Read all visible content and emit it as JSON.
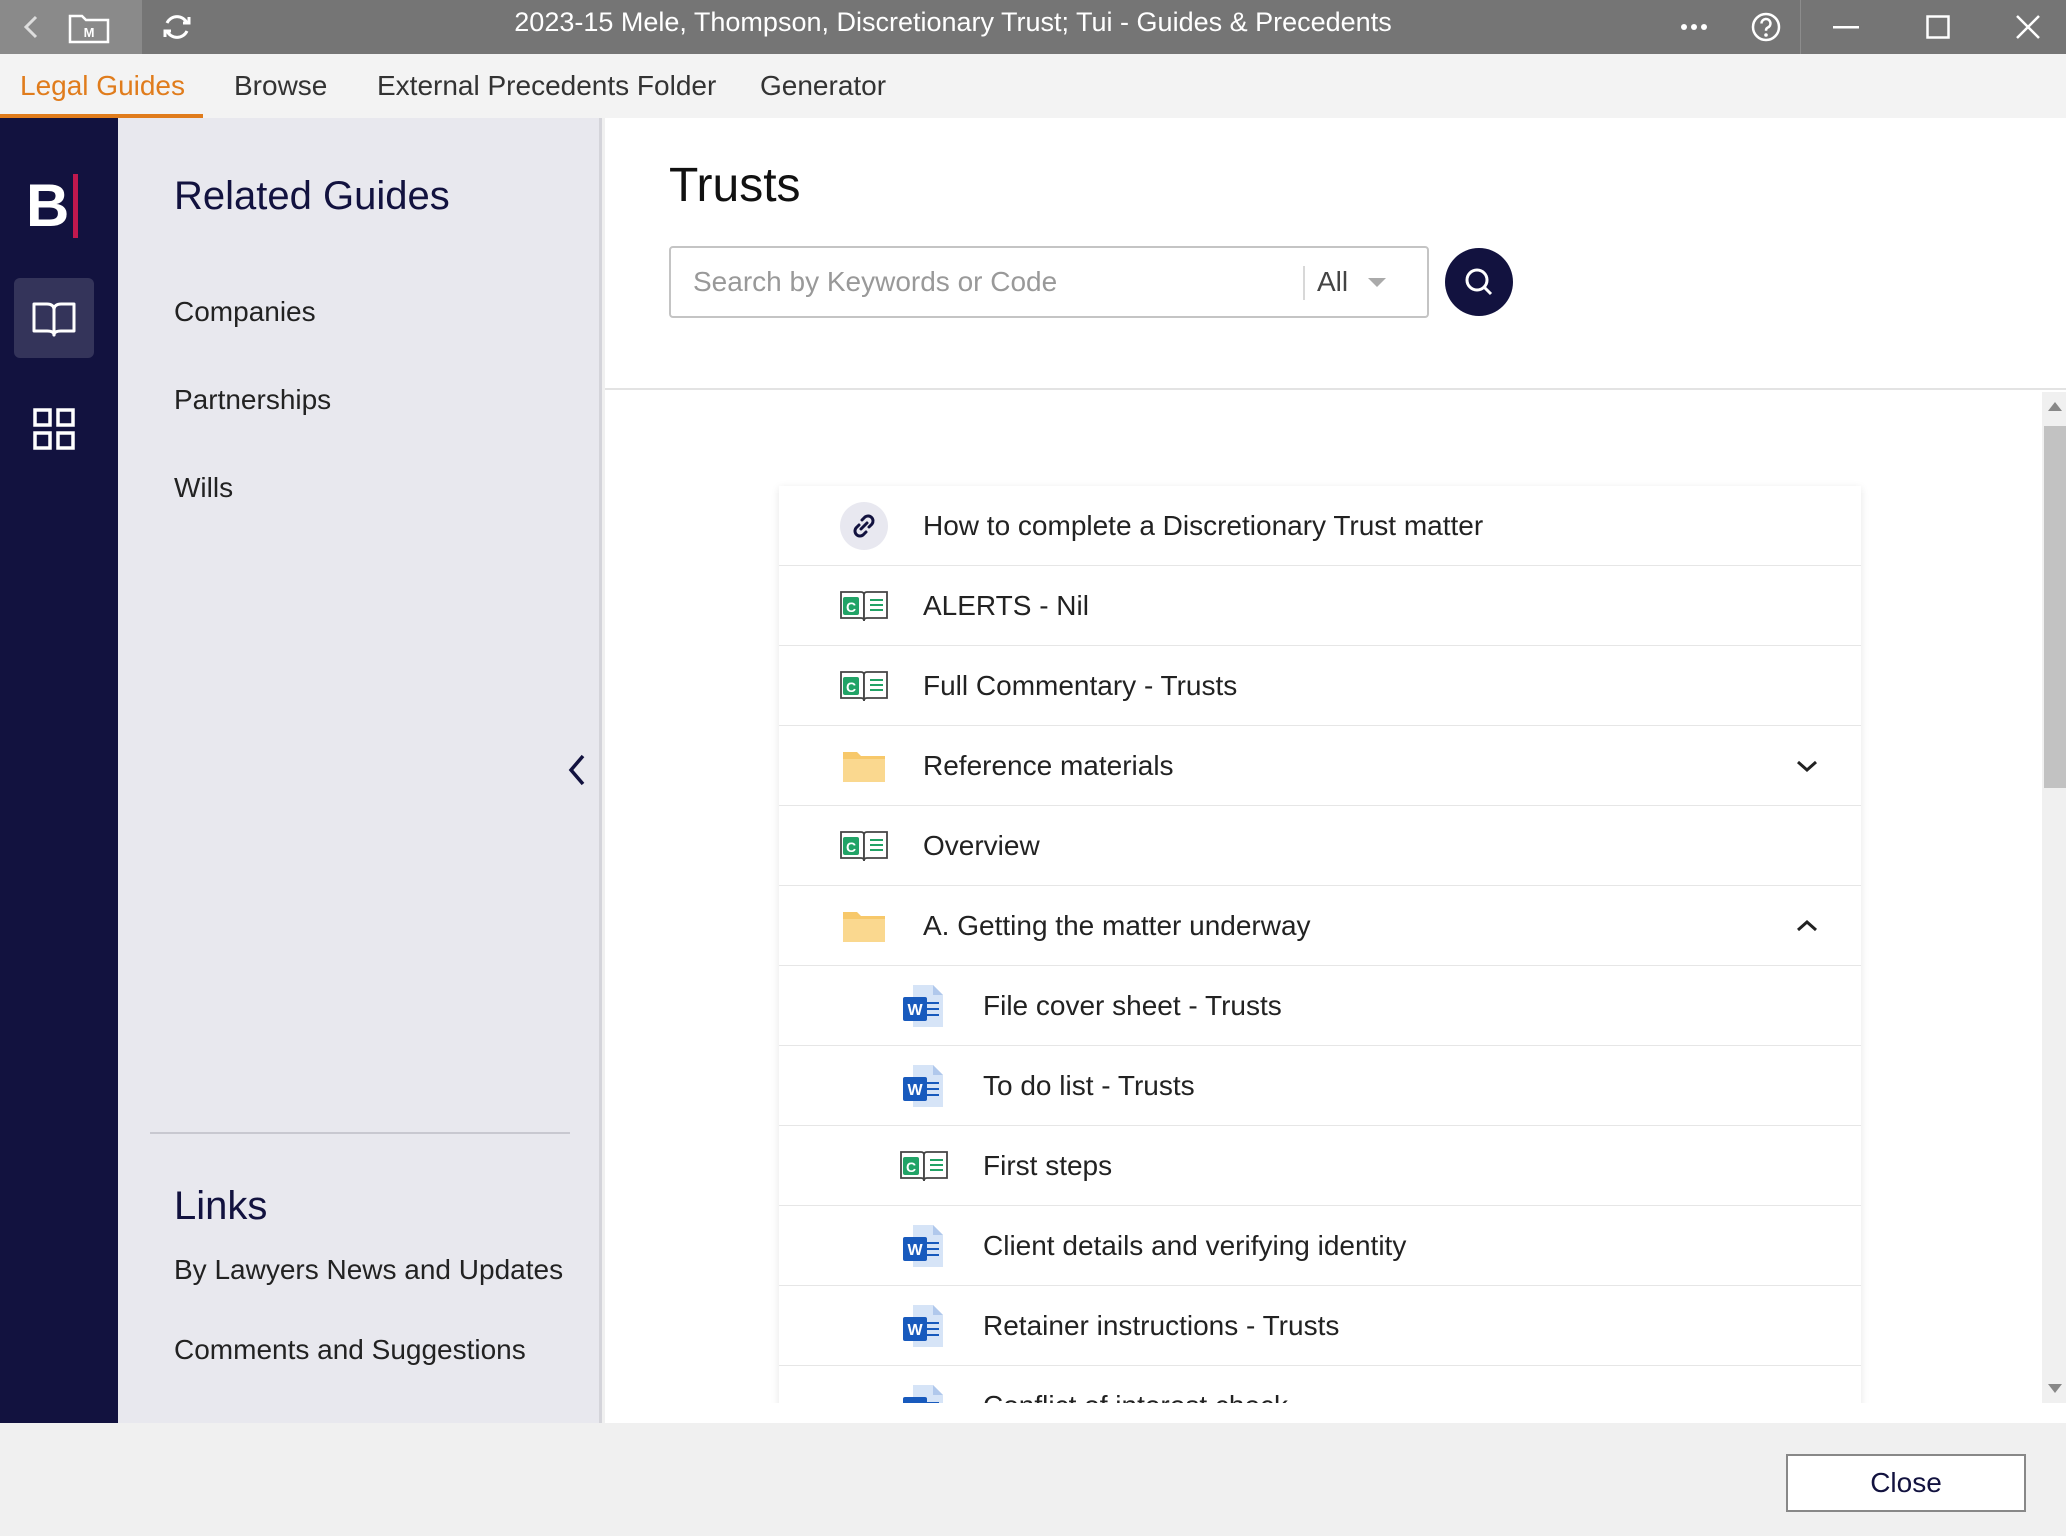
{
  "window": {
    "title": "2023-15 Mele, Thompson, Discretionary Trust; Tui - Guides & Precedents"
  },
  "tabs": [
    {
      "label": "Legal Guides"
    },
    {
      "label": "Browse"
    },
    {
      "label": "External Precedents Folder"
    },
    {
      "label": "Generator"
    }
  ],
  "rail": {
    "logo": "B"
  },
  "sidebar": {
    "related_heading": "Related Guides",
    "related_items": [
      {
        "label": "Companies"
      },
      {
        "label": "Partnerships"
      },
      {
        "label": "Wills"
      }
    ],
    "links_heading": "Links",
    "links_items": [
      {
        "label": "By Lawyers News and Updates"
      },
      {
        "label": "Comments and Suggestions"
      }
    ]
  },
  "main": {
    "title": "Trusts",
    "search": {
      "placeholder": "Search by Keywords or Code",
      "scope": "All"
    },
    "list": [
      {
        "label": "How to complete a Discretionary Trust matter",
        "icon": "link-icon"
      },
      {
        "label": "ALERTS - Nil",
        "icon": "commentary-book-icon"
      },
      {
        "label": "Full Commentary - Trusts",
        "icon": "commentary-book-icon"
      },
      {
        "label": "Reference materials",
        "icon": "folder-icon"
      },
      {
        "label": "Overview",
        "icon": "commentary-book-icon"
      },
      {
        "label": "A. Getting the matter underway",
        "icon": "folder-icon"
      },
      {
        "label": "File cover sheet - Trusts",
        "icon": "word-doc-icon"
      },
      {
        "label": "To do list - Trusts",
        "icon": "word-doc-icon"
      },
      {
        "label": "First steps",
        "icon": "commentary-book-icon"
      },
      {
        "label": "Client details and verifying identity",
        "icon": "word-doc-icon"
      },
      {
        "label": "Retainer instructions - Trusts",
        "icon": "word-doc-icon"
      },
      {
        "label": "Conflict of interest check",
        "icon": "word-doc-icon"
      }
    ]
  },
  "footer": {
    "close_label": "Close"
  },
  "colors": {
    "accent": "#e07c1c",
    "navy": "#12123f",
    "brand_red": "#c0184e",
    "word_blue": "#185abd",
    "commentary_green": "#21a366",
    "folder_yellow": "#f7c86a"
  }
}
